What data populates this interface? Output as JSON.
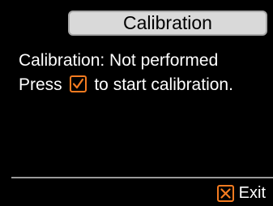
{
  "header": {
    "title": "Calibration"
  },
  "message": {
    "status_line": "Calibration: Not performed",
    "instruction_before": "Press",
    "instruction_after": "to start calibration.",
    "confirm_icon": "check-box-icon"
  },
  "footer": {
    "exit_label": "Exit",
    "exit_icon": "x-box-icon"
  },
  "colors": {
    "background": "#000000",
    "text": "#ffffff",
    "title_bg": "#d9d9d9",
    "accent": "#f47b20"
  }
}
